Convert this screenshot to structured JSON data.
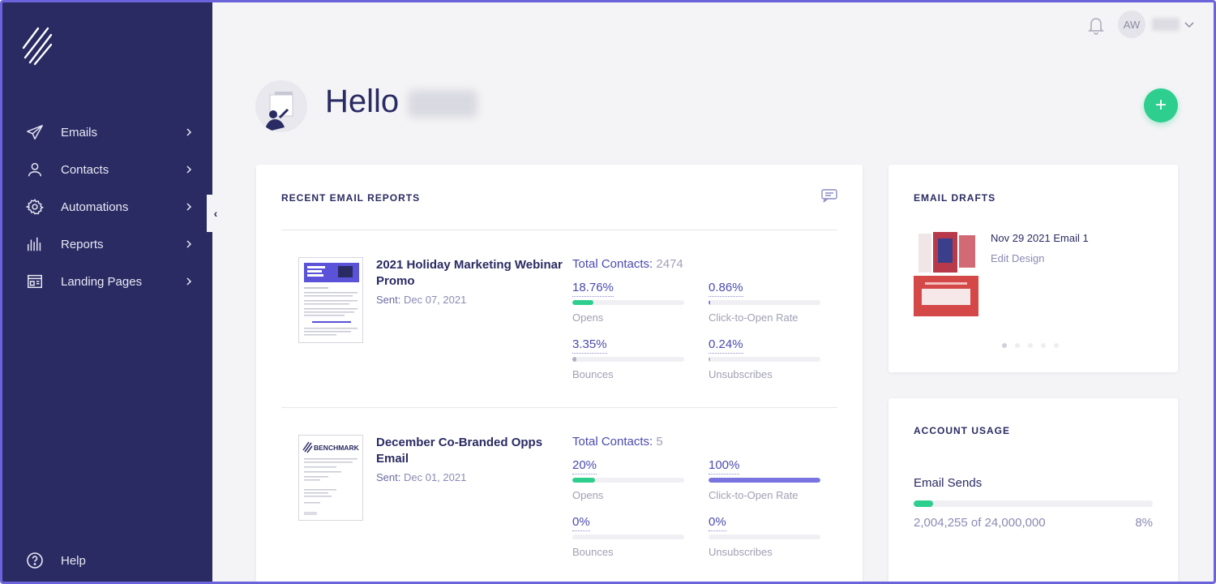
{
  "sidebar": {
    "items": [
      {
        "label": "Emails",
        "icon": "paper-plane-icon"
      },
      {
        "label": "Contacts",
        "icon": "user-icon"
      },
      {
        "label": "Automations",
        "icon": "gear-icon"
      },
      {
        "label": "Reports",
        "icon": "bar-chart-icon"
      },
      {
        "label": "Landing Pages",
        "icon": "landing-page-icon"
      }
    ],
    "help_label": "Help",
    "collapse_glyph": "‹"
  },
  "topbar": {
    "avatar_initials": "AW"
  },
  "greeting": {
    "hello": "Hello"
  },
  "fab": {
    "glyph": "+"
  },
  "reports": {
    "title": "RECENT EMAIL REPORTS",
    "items": [
      {
        "title": "2021 Holiday Marketing Webinar Promo",
        "sent_label": "Sent:",
        "sent_date": "Dec 07, 2021",
        "total_label": "Total Contacts:",
        "total": "2474",
        "metrics": [
          {
            "pct": "18.76%",
            "label": "Opens",
            "value": 0.1876
          },
          {
            "pct": "0.86%",
            "label": "Click-to-Open Rate",
            "value": 0.0086
          },
          {
            "pct": "3.35%",
            "label": "Bounces",
            "value": 0.0335
          },
          {
            "pct": "0.24%",
            "label": "Unsubscribes",
            "value": 0.0024
          }
        ]
      },
      {
        "title": "December Co-Branded Opps Email",
        "sent_label": "Sent:",
        "sent_date": "Dec 01, 2021",
        "total_label": "Total Contacts:",
        "total": "5",
        "metrics": [
          {
            "pct": "20%",
            "label": "Opens",
            "value": 0.2
          },
          {
            "pct": "100%",
            "label": "Click-to-Open Rate",
            "value": 1.0
          },
          {
            "pct": "0%",
            "label": "Bounces",
            "value": 0
          },
          {
            "pct": "0%",
            "label": "Unsubscribes",
            "value": 0
          }
        ]
      }
    ],
    "thumb_brand": "BENCHMARK"
  },
  "drafts": {
    "title": "EMAIL DRAFTS",
    "name": "Nov 29 2021 Email 1",
    "edit_label": "Edit Design"
  },
  "usage": {
    "title": "ACCOUNT USAGE",
    "label": "Email Sends",
    "count": "2,004,255 of 24,000,000",
    "pct": "8%",
    "value": 0.08
  },
  "colors": {
    "sidebar": "#2a2b63",
    "accent_green": "#2ecf8e",
    "accent_purple": "#6a63dc",
    "text_primary": "#2a2b63",
    "text_link": "#4a4ab0"
  }
}
